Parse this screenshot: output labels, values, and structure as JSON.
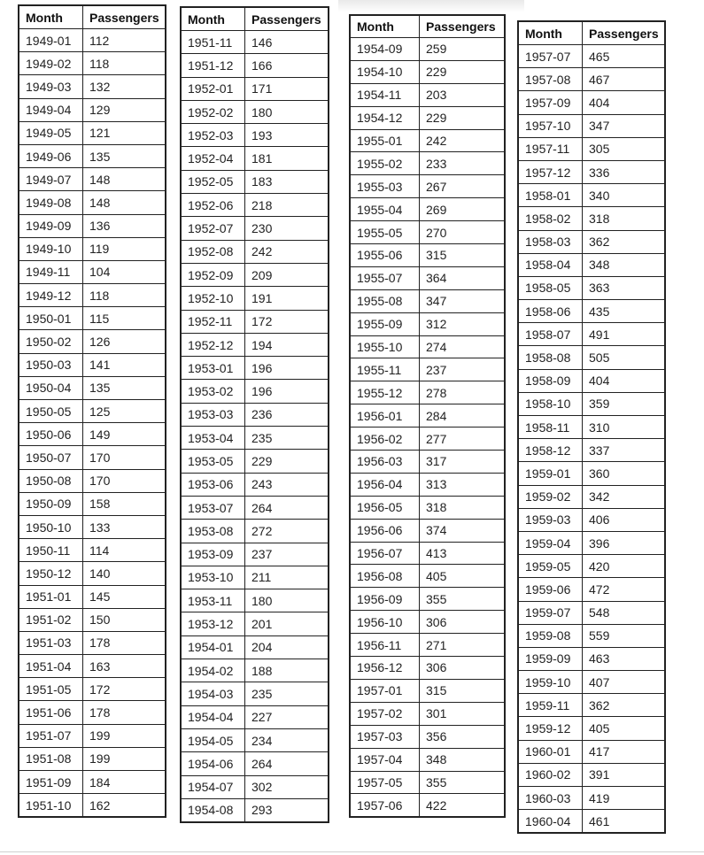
{
  "headers": {
    "month": "Month",
    "passengers": "Passengers"
  },
  "tables": [
    {
      "rows": [
        [
          "1949-01",
          "112"
        ],
        [
          "1949-02",
          "118"
        ],
        [
          "1949-03",
          "132"
        ],
        [
          "1949-04",
          "129"
        ],
        [
          "1949-05",
          "121"
        ],
        [
          "1949-06",
          "135"
        ],
        [
          "1949-07",
          "148"
        ],
        [
          "1949-08",
          "148"
        ],
        [
          "1949-09",
          "136"
        ],
        [
          "1949-10",
          "119"
        ],
        [
          "1949-11",
          "104"
        ],
        [
          "1949-12",
          "118"
        ],
        [
          "1950-01",
          "115"
        ],
        [
          "1950-02",
          "126"
        ],
        [
          "1950-03",
          "141"
        ],
        [
          "1950-04",
          "135"
        ],
        [
          "1950-05",
          "125"
        ],
        [
          "1950-06",
          "149"
        ],
        [
          "1950-07",
          "170"
        ],
        [
          "1950-08",
          "170"
        ],
        [
          "1950-09",
          "158"
        ],
        [
          "1950-10",
          "133"
        ],
        [
          "1950-11",
          "114"
        ],
        [
          "1950-12",
          "140"
        ],
        [
          "1951-01",
          "145"
        ],
        [
          "1951-02",
          "150"
        ],
        [
          "1951-03",
          "178"
        ],
        [
          "1951-04",
          "163"
        ],
        [
          "1951-05",
          "172"
        ],
        [
          "1951-06",
          "178"
        ],
        [
          "1951-07",
          "199"
        ],
        [
          "1951-08",
          "199"
        ],
        [
          "1951-09",
          "184"
        ],
        [
          "1951-10",
          "162"
        ]
      ]
    },
    {
      "rows": [
        [
          "1951-11",
          "146"
        ],
        [
          "1951-12",
          "166"
        ],
        [
          "1952-01",
          "171"
        ],
        [
          "1952-02",
          "180"
        ],
        [
          "1952-03",
          "193"
        ],
        [
          "1952-04",
          "181"
        ],
        [
          "1952-05",
          "183"
        ],
        [
          "1952-06",
          "218"
        ],
        [
          "1952-07",
          "230"
        ],
        [
          "1952-08",
          "242"
        ],
        [
          "1952-09",
          "209"
        ],
        [
          "1952-10",
          "191"
        ],
        [
          "1952-11",
          "172"
        ],
        [
          "1952-12",
          "194"
        ],
        [
          "1953-01",
          "196"
        ],
        [
          "1953-02",
          "196"
        ],
        [
          "1953-03",
          "236"
        ],
        [
          "1953-04",
          "235"
        ],
        [
          "1953-05",
          "229"
        ],
        [
          "1953-06",
          "243"
        ],
        [
          "1953-07",
          "264"
        ],
        [
          "1953-08",
          "272"
        ],
        [
          "1953-09",
          "237"
        ],
        [
          "1953-10",
          "211"
        ],
        [
          "1953-11",
          "180"
        ],
        [
          "1953-12",
          "201"
        ],
        [
          "1954-01",
          "204"
        ],
        [
          "1954-02",
          "188"
        ],
        [
          "1954-03",
          "235"
        ],
        [
          "1954-04",
          "227"
        ],
        [
          "1954-05",
          "234"
        ],
        [
          "1954-06",
          "264"
        ],
        [
          "1954-07",
          "302"
        ],
        [
          "1954-08",
          "293"
        ]
      ]
    },
    {
      "rows": [
        [
          "1954-09",
          "259"
        ],
        [
          "1954-10",
          "229"
        ],
        [
          "1954-11",
          "203"
        ],
        [
          "1954-12",
          "229"
        ],
        [
          "1955-01",
          "242"
        ],
        [
          "1955-02",
          "233"
        ],
        [
          "1955-03",
          "267"
        ],
        [
          "1955-04",
          "269"
        ],
        [
          "1955-05",
          "270"
        ],
        [
          "1955-06",
          "315"
        ],
        [
          "1955-07",
          "364"
        ],
        [
          "1955-08",
          "347"
        ],
        [
          "1955-09",
          "312"
        ],
        [
          "1955-10",
          "274"
        ],
        [
          "1955-11",
          "237"
        ],
        [
          "1955-12",
          "278"
        ],
        [
          "1956-01",
          "284"
        ],
        [
          "1956-02",
          "277"
        ],
        [
          "1956-03",
          "317"
        ],
        [
          "1956-04",
          "313"
        ],
        [
          "1956-05",
          "318"
        ],
        [
          "1956-06",
          "374"
        ],
        [
          "1956-07",
          "413"
        ],
        [
          "1956-08",
          "405"
        ],
        [
          "1956-09",
          "355"
        ],
        [
          "1956-10",
          "306"
        ],
        [
          "1956-11",
          "271"
        ],
        [
          "1956-12",
          "306"
        ],
        [
          "1957-01",
          "315"
        ],
        [
          "1957-02",
          "301"
        ],
        [
          "1957-03",
          "356"
        ],
        [
          "1957-04",
          "348"
        ],
        [
          "1957-05",
          "355"
        ],
        [
          "1957-06",
          "422"
        ]
      ]
    },
    {
      "rows": [
        [
          "1957-07",
          "465"
        ],
        [
          "1957-08",
          "467"
        ],
        [
          "1957-09",
          "404"
        ],
        [
          "1957-10",
          "347"
        ],
        [
          "1957-11",
          "305"
        ],
        [
          "1957-12",
          "336"
        ],
        [
          "1958-01",
          "340"
        ],
        [
          "1958-02",
          "318"
        ],
        [
          "1958-03",
          "362"
        ],
        [
          "1958-04",
          "348"
        ],
        [
          "1958-05",
          "363"
        ],
        [
          "1958-06",
          "435"
        ],
        [
          "1958-07",
          "491"
        ],
        [
          "1958-08",
          "505"
        ],
        [
          "1958-09",
          "404"
        ],
        [
          "1958-10",
          "359"
        ],
        [
          "1958-11",
          "310"
        ],
        [
          "1958-12",
          "337"
        ],
        [
          "1959-01",
          "360"
        ],
        [
          "1959-02",
          "342"
        ],
        [
          "1959-03",
          "406"
        ],
        [
          "1959-04",
          "396"
        ],
        [
          "1959-05",
          "420"
        ],
        [
          "1959-06",
          "472"
        ],
        [
          "1959-07",
          "548"
        ],
        [
          "1959-08",
          "559"
        ],
        [
          "1959-09",
          "463"
        ],
        [
          "1959-10",
          "407"
        ],
        [
          "1959-11",
          "362"
        ],
        [
          "1959-12",
          "405"
        ],
        [
          "1960-01",
          "417"
        ],
        [
          "1960-02",
          "391"
        ],
        [
          "1960-03",
          "419"
        ],
        [
          "1960-04",
          "461"
        ]
      ]
    }
  ]
}
